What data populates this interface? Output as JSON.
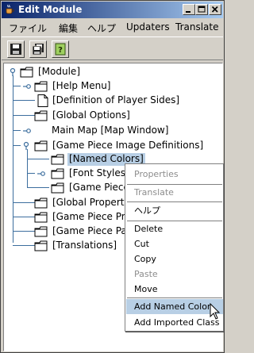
{
  "window": {
    "title": "Edit Module"
  },
  "menubar": {
    "items": [
      "ファイル",
      "編集",
      "ヘルプ",
      "Updaters",
      "Translate"
    ]
  },
  "toolbar": {
    "buttons": [
      "save-icon",
      "save-as-icon",
      "help-icon"
    ]
  },
  "tree": {
    "nodes": [
      {
        "label": "[Module]"
      },
      {
        "label": "[Help Menu]"
      },
      {
        "label": "[Definition of Player Sides]"
      },
      {
        "label": "[Global Options]"
      },
      {
        "label": "Main Map [Map Window]"
      },
      {
        "label": "[Game Piece Image Definitions]"
      },
      {
        "label": "[Named Colors]"
      },
      {
        "label": "[Font Styles]"
      },
      {
        "label": "[Game Piece"
      },
      {
        "label": "[Global Propertie"
      },
      {
        "label": "[Game Piece Pro"
      },
      {
        "label": "[Game Piece Pa"
      },
      {
        "label": "[Translations]"
      }
    ]
  },
  "context_menu": {
    "items": [
      {
        "label": "Properties",
        "enabled": false
      },
      {
        "label": "Translate",
        "enabled": false
      },
      {
        "label": "ヘルプ",
        "enabled": true
      },
      {
        "label": "Delete",
        "enabled": true
      },
      {
        "label": "Cut",
        "enabled": true
      },
      {
        "label": "Copy",
        "enabled": true
      },
      {
        "label": "Paste",
        "enabled": false
      },
      {
        "label": "Move",
        "enabled": true
      },
      {
        "label": "Add Named Color",
        "enabled": true,
        "highlighted": true
      },
      {
        "label": "Add Imported Class",
        "enabled": true
      }
    ]
  },
  "colors": {
    "titlebar_start": "#0a246a",
    "titlebar_end": "#a6caf0",
    "selection": "#b8cfe5",
    "tree_lines": "#3c6e9e"
  }
}
